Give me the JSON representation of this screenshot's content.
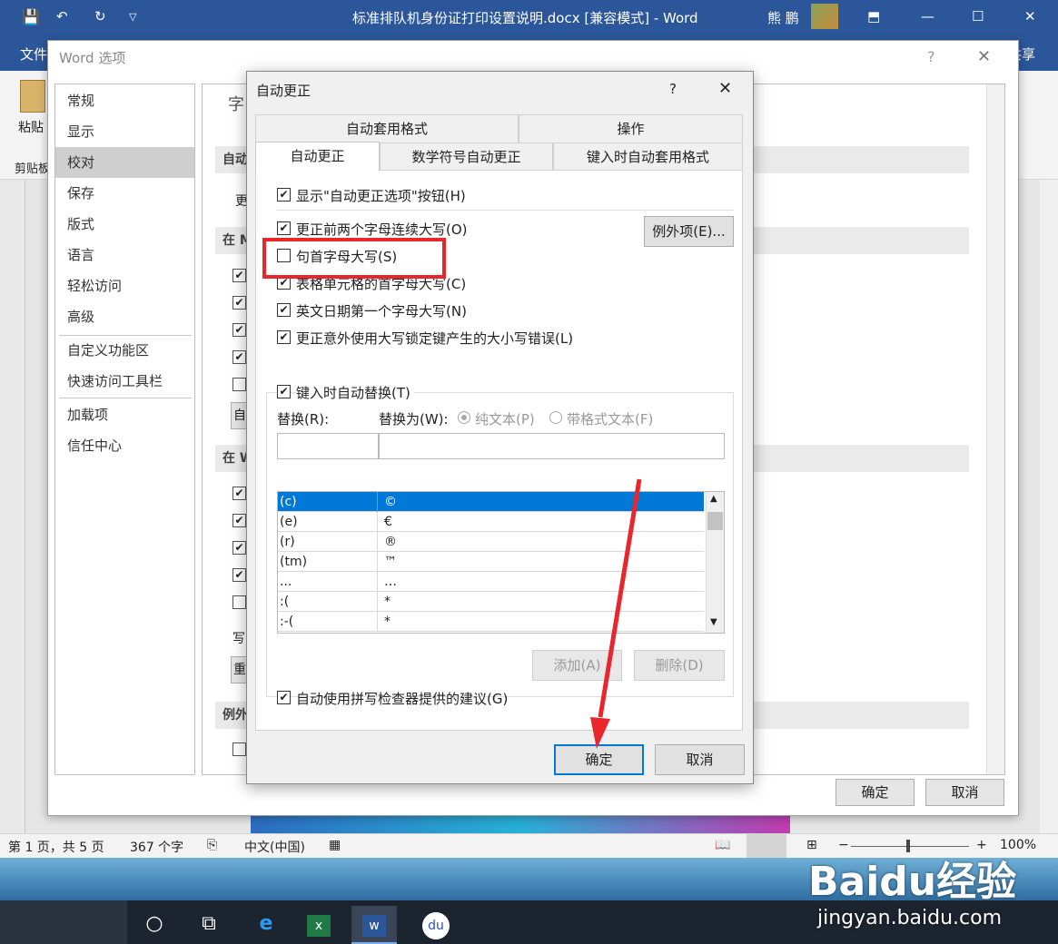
{
  "word": {
    "title": "标准排队机身份证打印设置说明.docx [兼容模式] - Word",
    "user": "熊 鹏",
    "tab_file": "文件",
    "tab_share": "共享",
    "paste_label": "粘贴",
    "clipboard_label": "剪贴板"
  },
  "options": {
    "title": "Word 选项",
    "help": "?",
    "close": "✕",
    "nav": [
      "常规",
      "显示",
      "校对",
      "保存",
      "版式",
      "语言",
      "轻松访问",
      "高级",
      "自定义功能区",
      "快速访问工具栏",
      "加载项",
      "信任中心"
    ],
    "active_nav": "校对",
    "partial": {
      "zi": "字",
      "zidong": "自动",
      "geng": "更",
      "zaim": "在 M",
      "zi2": "自",
      "zaiw": "在 W",
      "xie": "写",
      "zhong": "重",
      "liwai": "例外"
    },
    "ok": "确定",
    "cancel": "取消"
  },
  "autocorrect": {
    "title": "自动更正",
    "help": "?",
    "close": "✕",
    "tabs_top": [
      "自动套用格式",
      "操作"
    ],
    "tabs_bottom": [
      "自动更正",
      "数学符号自动更正",
      "键入时自动套用格式"
    ],
    "show_buttons": "显示\"自动更正选项\"按钮(H)",
    "opt_two_initial": "更正前两个字母连续大写(O)",
    "exceptions": "例外项(E)...",
    "opt_sentence": "句首字母大写(S)",
    "opt_table_cell": "表格单元格的首字母大写(C)",
    "opt_day_names": "英文日期第一个字母大写(N)",
    "opt_caps_lock": "更正意外使用大写锁定键产生的大小写错误(L)",
    "replace_as_type": "键入时自动替换(T)",
    "replace_label": "替换(R):",
    "with_label": "替换为(W):",
    "plain_text": "纯文本(P)",
    "formatted_text": "带格式文本(F)",
    "entries": [
      {
        "from": "(c)",
        "to": "©"
      },
      {
        "from": "(e)",
        "to": "€"
      },
      {
        "from": "(r)",
        "to": "®"
      },
      {
        "from": "(tm)",
        "to": "™"
      },
      {
        "from": "...",
        "to": "…"
      },
      {
        "from": ":(",
        "to": "*"
      },
      {
        "from": ":-(",
        "to": "*"
      }
    ],
    "add": "添加(A)",
    "delete": "删除(D)",
    "spell_suggest": "自动使用拼写检查器提供的建议(G)",
    "ok": "确定",
    "cancel": "取消"
  },
  "status": {
    "page": "第 1 页，共 5 页",
    "words": "367 个字",
    "lang": "中文(中国)",
    "zoom": "100%",
    "minus": "−",
    "plus": "+"
  },
  "watermark": {
    "brand": "Baidu经验",
    "url": "jingyan.baidu.com"
  },
  "colors": {
    "word_blue": "#2b579a",
    "highlight_red": "#e8262b",
    "select_blue": "#0078d7"
  }
}
